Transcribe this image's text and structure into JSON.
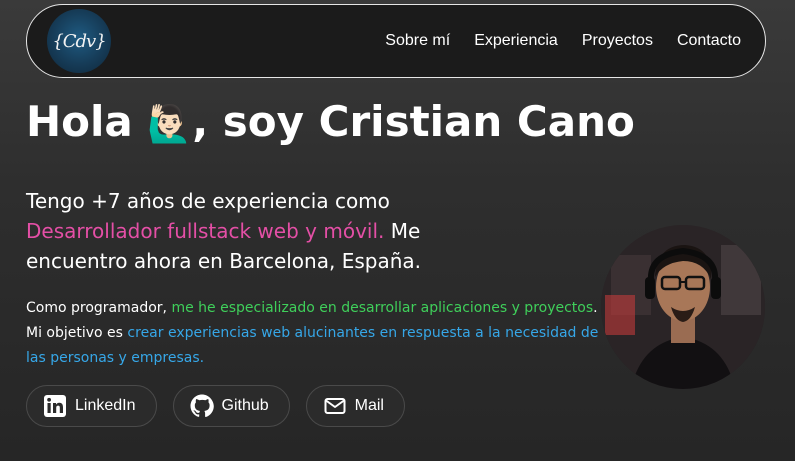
{
  "nav": {
    "logo_text": "{Cdv}",
    "links": [
      "Sobre mí",
      "Experiencia",
      "Proyectos",
      "Contacto"
    ]
  },
  "hero": {
    "title_before": "Hola ",
    "title_emoji": "🙋🏻‍♂️",
    "title_after": ", soy Cristian Cano",
    "intro_part1": "Tengo +7 años de experiencia como ",
    "intro_highlight": "Desarrollador fullstack web y móvil.",
    "intro_part2": " Me encuentro ahora en Barcelona, España.",
    "desc_part1": "Como programador, ",
    "desc_green": "me he especializado en desarrollar aplicaciones y proyectos",
    "desc_part2": ". Mi objetivo es ",
    "desc_blue": "crear experiencias web alucinantes en respuesta a la necesidad de las personas y empresas."
  },
  "social": {
    "linkedin": "LinkedIn",
    "github": "Github",
    "mail": "Mail"
  },
  "colors": {
    "pink_accent": "#e44fa6",
    "green_accent": "#3fcf5a",
    "blue_accent": "#36a7e8"
  },
  "icons": [
    "linkedin-icon",
    "github-icon",
    "mail-icon"
  ]
}
